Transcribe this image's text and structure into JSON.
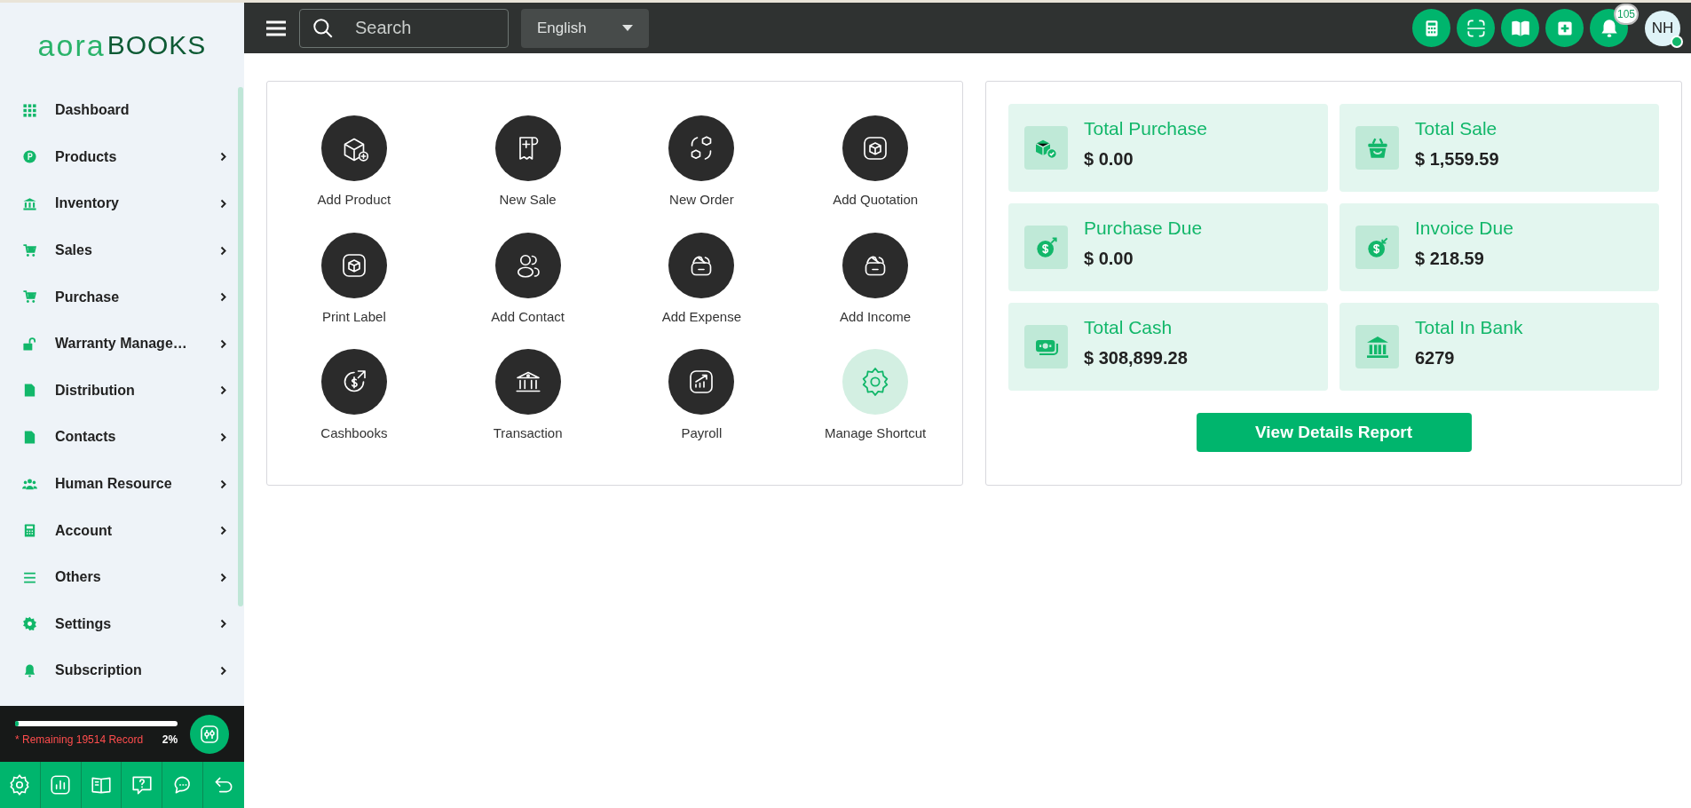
{
  "logo": {
    "part_1": "aora",
    "part_2": "BOOKS"
  },
  "sidebar": {
    "items": [
      {
        "label": "Dashboard",
        "expandable": false
      },
      {
        "label": "Products",
        "expandable": true
      },
      {
        "label": "Inventory",
        "expandable": true
      },
      {
        "label": "Sales",
        "expandable": true
      },
      {
        "label": "Purchase",
        "expandable": true
      },
      {
        "label": "Warranty Manage…",
        "expandable": true
      },
      {
        "label": "Distribution",
        "expandable": true
      },
      {
        "label": "Contacts",
        "expandable": true
      },
      {
        "label": "Human Resource",
        "expandable": true
      },
      {
        "label": "Account",
        "expandable": true
      },
      {
        "label": "Others",
        "expandable": true
      },
      {
        "label": "Settings",
        "expandable": true
      },
      {
        "label": "Subscription",
        "expandable": true
      }
    ],
    "usage": {
      "level": 0.02,
      "note": "* Remaining 19514 Record",
      "percent": "2%"
    }
  },
  "topbar": {
    "search": {
      "placeholder": "Search"
    },
    "language": "English",
    "notifications_count": "105",
    "avatar": "NH",
    "online": true
  },
  "shortcuts": [
    {
      "label": "Add Product",
      "kind": "action"
    },
    {
      "label": "New Sale",
      "kind": "action"
    },
    {
      "label": "New Order",
      "kind": "action"
    },
    {
      "label": "Add Quotation",
      "kind": "action"
    },
    {
      "label": "Print Label",
      "kind": "action"
    },
    {
      "label": "Add Contact",
      "kind": "action"
    },
    {
      "label": "Add Expense",
      "kind": "action"
    },
    {
      "label": "Add Income",
      "kind": "action"
    },
    {
      "label": "Cashbooks",
      "kind": "action"
    },
    {
      "label": "Transaction",
      "kind": "action"
    },
    {
      "label": "Payroll",
      "kind": "action"
    },
    {
      "label": "Manage Shortcut",
      "kind": "manage"
    }
  ],
  "stats": [
    {
      "title": "Total Purchase",
      "value": "$ 0.00"
    },
    {
      "title": "Total Sale",
      "value": "$ 1,559.59"
    },
    {
      "title": "Purchase Due",
      "value": "$ 0.00"
    },
    {
      "title": "Invoice Due",
      "value": "$ 218.59"
    },
    {
      "title": "Total Cash",
      "value": "$ 308,899.28"
    },
    {
      "title": "Total In Bank",
      "value": "6279"
    }
  ],
  "report_button": "View Details Report"
}
